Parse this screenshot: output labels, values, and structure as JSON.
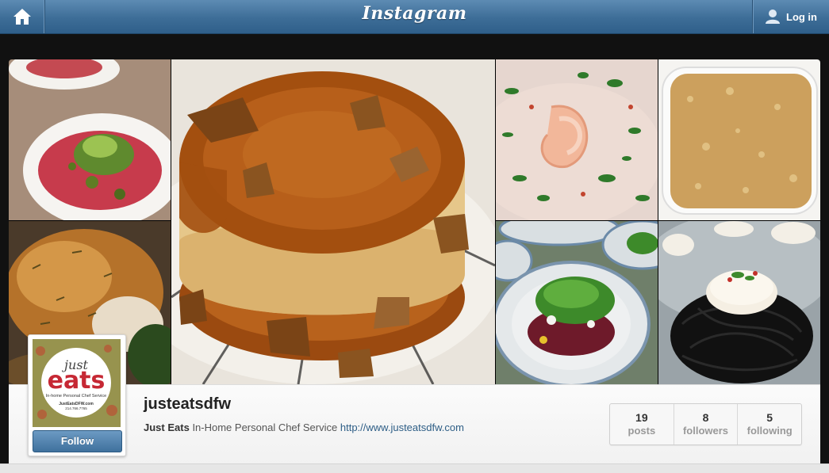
{
  "topbar": {
    "home_icon": "home-icon",
    "logo_text": "Instagram",
    "login_label": "Log in",
    "login_icon": "user-icon",
    "color": "#3f6f99"
  },
  "photos": [
    "beef-carpaccio-microgreens",
    "flan-caramel-brittle",
    "shrimp-soup-herbs",
    "breadcrumb-gratin",
    "roasted-chicken-herbs",
    "beet-salad-arugula",
    "scallop-squid-ink-pasta"
  ],
  "profile": {
    "avatar_brand_top": "just",
    "avatar_brand_bottom": "eats",
    "avatar_tagline": "In-home Personal Chef Service",
    "avatar_site": "JustEatsDFW.com",
    "avatar_phone": "214.766.7765",
    "follow_label": "Follow",
    "username": "justeatsdfw",
    "full_name": "Just Eats",
    "bio": "In-Home Personal Chef Service",
    "website": "http://www.justeatsdfw.com"
  },
  "stats": [
    {
      "value": "19",
      "label": "posts"
    },
    {
      "value": "8",
      "label": "followers"
    },
    {
      "value": "5",
      "label": "following"
    }
  ]
}
